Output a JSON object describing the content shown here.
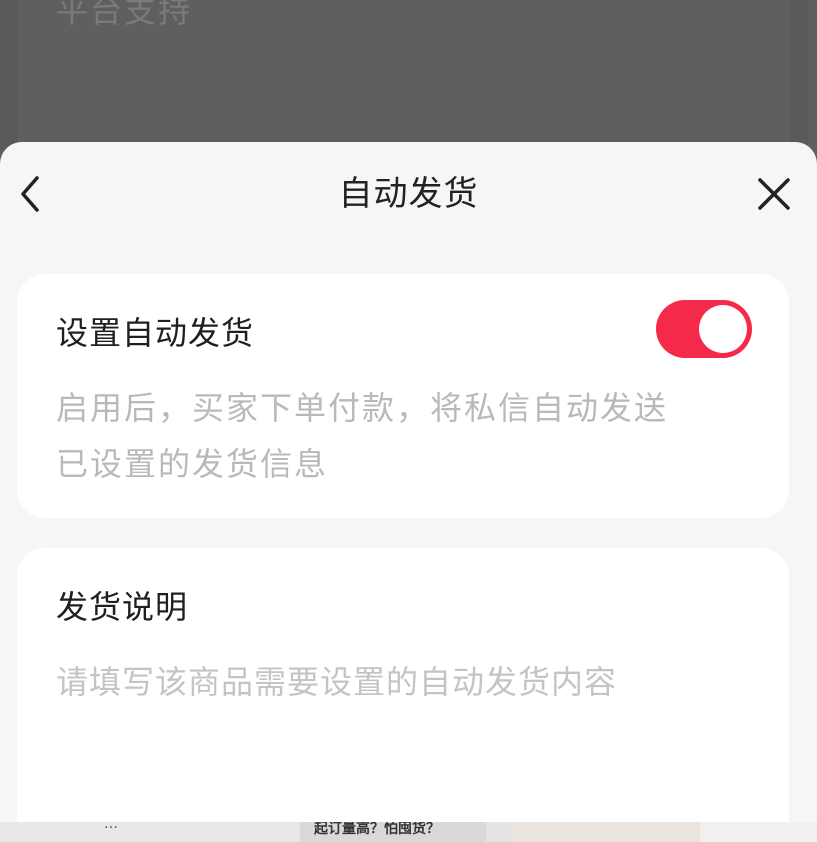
{
  "background": {
    "title": "平台支持"
  },
  "sheet": {
    "title": "自动发货",
    "back_icon": "chevron-left-icon",
    "close_icon": "close-icon"
  },
  "auto_ship": {
    "label": "设置自动发货",
    "enabled": true,
    "toggle_color": "#f5294a",
    "description_line1": "启用后，买家下单付款，将私信自动发送",
    "description_line2": "已设置的发货信息"
  },
  "instructions": {
    "label": "发货说明",
    "placeholder": "请填写该商品需要设置的自动发货内容"
  },
  "bottom_strip": {
    "text1": "…",
    "text2": "起订量高？怕囤货？"
  }
}
